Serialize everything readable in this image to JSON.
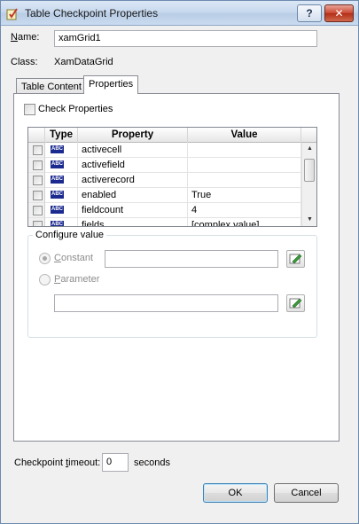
{
  "window": {
    "title": "Table Checkpoint Properties",
    "help_label": "?",
    "close_label": "✕"
  },
  "name": {
    "label": "Name:",
    "value": "xamGrid1"
  },
  "class": {
    "label": "Class:",
    "value": "XamDataGrid"
  },
  "tabs": [
    {
      "label": "Table Content",
      "active": false
    },
    {
      "label": "Properties",
      "active": true
    }
  ],
  "check_properties": {
    "label": "Check Properties",
    "checked": false
  },
  "grid": {
    "headers": {
      "type": "Type",
      "property": "Property",
      "value": "Value"
    },
    "rows": [
      {
        "type_icon": "ABC",
        "property": "activecell",
        "value": ""
      },
      {
        "type_icon": "ABC",
        "property": "activefield",
        "value": ""
      },
      {
        "type_icon": "ABC",
        "property": "activerecord",
        "value": ""
      },
      {
        "type_icon": "ABC",
        "property": "enabled",
        "value": "True"
      },
      {
        "type_icon": "ABC",
        "property": "fieldcount",
        "value": "4"
      },
      {
        "type_icon": "ABC",
        "property": "fields",
        "value": "[complex value]"
      }
    ]
  },
  "configure": {
    "title": "Configure value",
    "constant_label": "Constant",
    "parameter_label": "Parameter",
    "constant_value": "",
    "parameter_value": ""
  },
  "timeout": {
    "label": "Checkpoint timeout:",
    "value": "0",
    "unit": "seconds"
  },
  "buttons": {
    "ok": "OK",
    "cancel": "Cancel"
  },
  "colors": {
    "accent": "#3c7fb1",
    "abc_icon": "#1b2a8f",
    "close": "#c8452e"
  }
}
